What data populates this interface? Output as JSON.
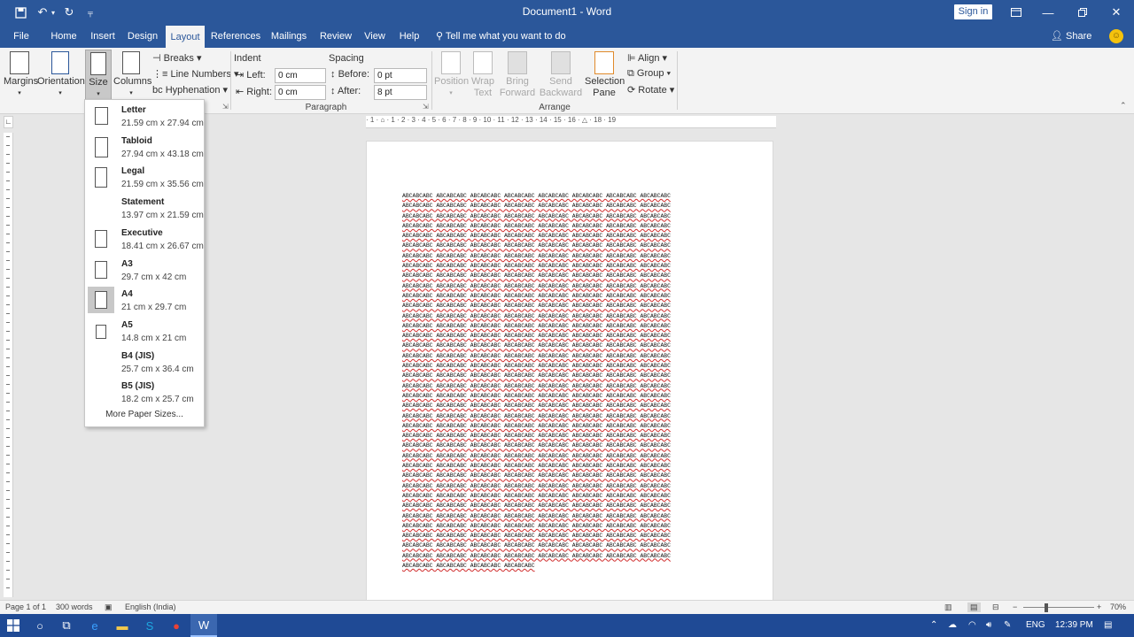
{
  "window": {
    "title": "Document1 - Word",
    "sign_in": "Sign in"
  },
  "quick_access": [
    "save-icon",
    "undo-icon",
    "redo-icon",
    "customize-icon"
  ],
  "tabs": [
    "File",
    "Home",
    "Insert",
    "Design",
    "Layout",
    "References",
    "Mailings",
    "Review",
    "View",
    "Help"
  ],
  "active_tab": "Layout",
  "tell_me": "Tell me what you want to do",
  "share": "Share",
  "ribbon": {
    "page_setup": {
      "margins": "Margins",
      "orientation": "Orientation",
      "size": "Size",
      "columns": "Columns",
      "breaks": "Breaks",
      "line_numbers": "Line Numbers",
      "hyphenation": "Hyphenation"
    },
    "indent": {
      "heading": "Indent",
      "left_label": "Left:",
      "left_value": "0 cm",
      "right_label": "Right:",
      "right_value": "0 cm"
    },
    "spacing": {
      "heading": "Spacing",
      "before_label": "Before:",
      "before_value": "0 pt",
      "after_label": "After:",
      "after_value": "8 pt"
    },
    "paragraph_group": "Paragraph",
    "arrange": {
      "position": "Position",
      "wrap_text_1": "Wrap",
      "wrap_text_2": "Text",
      "bring_forward_1": "Bring",
      "bring_forward_2": "Forward",
      "send_backward_1": "Send",
      "send_backward_2": "Backward",
      "selection_pane_1": "Selection",
      "selection_pane_2": "Pane",
      "align": "Align",
      "group": "Group",
      "rotate": "Rotate",
      "group_label": "Arrange"
    }
  },
  "size_menu": {
    "options": [
      {
        "name": "Letter",
        "dims": "21.59 cm x 27.94 cm",
        "icon": "page",
        "wr": 0.73
      },
      {
        "name": "Tabloid",
        "dims": "27.94 cm x 43.18 cm",
        "icon": "page",
        "wr": 0.65
      },
      {
        "name": "Legal",
        "dims": "21.59 cm x 35.56 cm",
        "icon": "page",
        "wr": 0.6
      },
      {
        "name": "Statement",
        "dims": "13.97 cm x 21.59 cm",
        "icon": "none",
        "wr": 0
      },
      {
        "name": "Executive",
        "dims": "18.41 cm x 26.67 cm",
        "icon": "page",
        "wr": 0.69
      },
      {
        "name": "A3",
        "dims": "29.7 cm x 42 cm",
        "icon": "page",
        "wr": 0.71
      },
      {
        "name": "A4",
        "dims": "21 cm x 29.7 cm",
        "icon": "page",
        "wr": 0.71
      },
      {
        "name": "A5",
        "dims": "14.8 cm x 21 cm",
        "icon": "page",
        "wr": 0.71
      },
      {
        "name": "B4 (JIS)",
        "dims": "25.7 cm x 36.4 cm",
        "icon": "none",
        "wr": 0
      },
      {
        "name": "B5 (JIS)",
        "dims": "18.2 cm x 25.7 cm",
        "icon": "none",
        "wr": 0
      }
    ],
    "selected": "A4",
    "more": "More Paper Sizes..."
  },
  "ruler": {
    "horizontal": "· 1 · ⌂ · 1 · 2 · 3 · 4 · 5 · 6 · 7 · 8 · 9 · 10 · 11 · 12 · 13 · 14 · 15 · 16 · △ · 18 · 19"
  },
  "document": {
    "first_word": "ABCABCABC",
    "word": "ABCABCABC",
    "words_per_line": 8,
    "line_count": 38,
    "last_line_words": 4
  },
  "status": {
    "page": "Page 1 of 1",
    "words": "300 words",
    "language": "English (India)",
    "zoom": "70%"
  },
  "taskbar": {
    "language": "ENG",
    "time": "12:39 PM"
  }
}
